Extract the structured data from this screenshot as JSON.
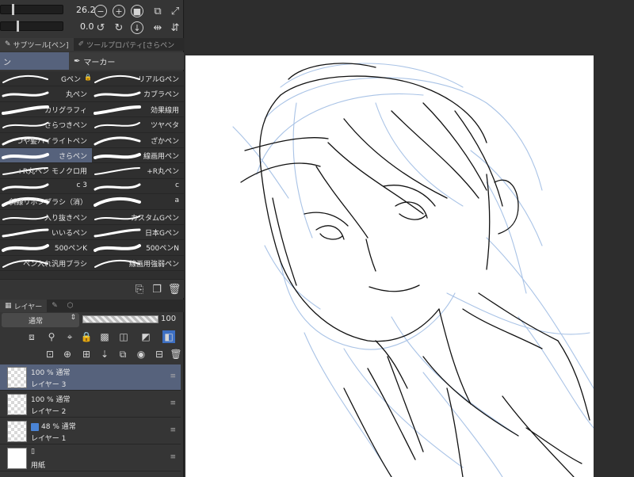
{
  "controls": {
    "size_value": "26.2",
    "angle_value": "0.0"
  },
  "tabs": {
    "subtool": "サブツール[ペン]",
    "tool_property": "ツールプロパティ[さらペン"
  },
  "subtabs": {
    "pen": "ン",
    "marker": "マーカー"
  },
  "brushes_left": [
    {
      "name": "Gペン",
      "lock": "🔒"
    },
    {
      "name": "丸ペン"
    },
    {
      "name": "カリグラフィ"
    },
    {
      "name": "さらつきペン"
    },
    {
      "name": "つや髪ハイライトペン"
    },
    {
      "name": "さらペン",
      "selected": true
    },
    {
      "name": "+R丸ペン モノクロ用"
    },
    {
      "name": "c 3"
    },
    {
      "name": "斜線リボンブラシ（消）"
    },
    {
      "name": "入り抜きペン"
    },
    {
      "name": "いいるペン"
    },
    {
      "name": "500ペンK"
    },
    {
      "name": "ペン入れ汎用ブラシ"
    }
  ],
  "brushes_right": [
    {
      "name": "リアルGペン"
    },
    {
      "name": "カブラペン"
    },
    {
      "name": "効果線用"
    },
    {
      "name": "ツヤベタ"
    },
    {
      "name": "ざかペン"
    },
    {
      "name": "線画用ペン"
    },
    {
      "name": "+R丸ペン"
    },
    {
      "name": "c"
    },
    {
      "name": "a"
    },
    {
      "name": "カスタムGペン"
    },
    {
      "name": "日本Gペン"
    },
    {
      "name": "500ペンN"
    },
    {
      "name": "線画用強弱ペン"
    }
  ],
  "layer_panel": {
    "tab": "レイヤー",
    "blend_mode": "通常",
    "opacity": "100"
  },
  "layers": [
    {
      "props": "100 %  通常",
      "name": "レイヤー 3",
      "selected": true
    },
    {
      "props": "100 %  通常",
      "name": "レイヤー 2"
    },
    {
      "props": "48 %  通常",
      "name": "レイヤー 1",
      "badge": true
    },
    {
      "props": "",
      "name": "用紙",
      "paper": true
    }
  ],
  "icons": {
    "minus": "minus-circle-icon",
    "plus": "plus-circle-icon",
    "stop": "stop-circle-icon"
  }
}
